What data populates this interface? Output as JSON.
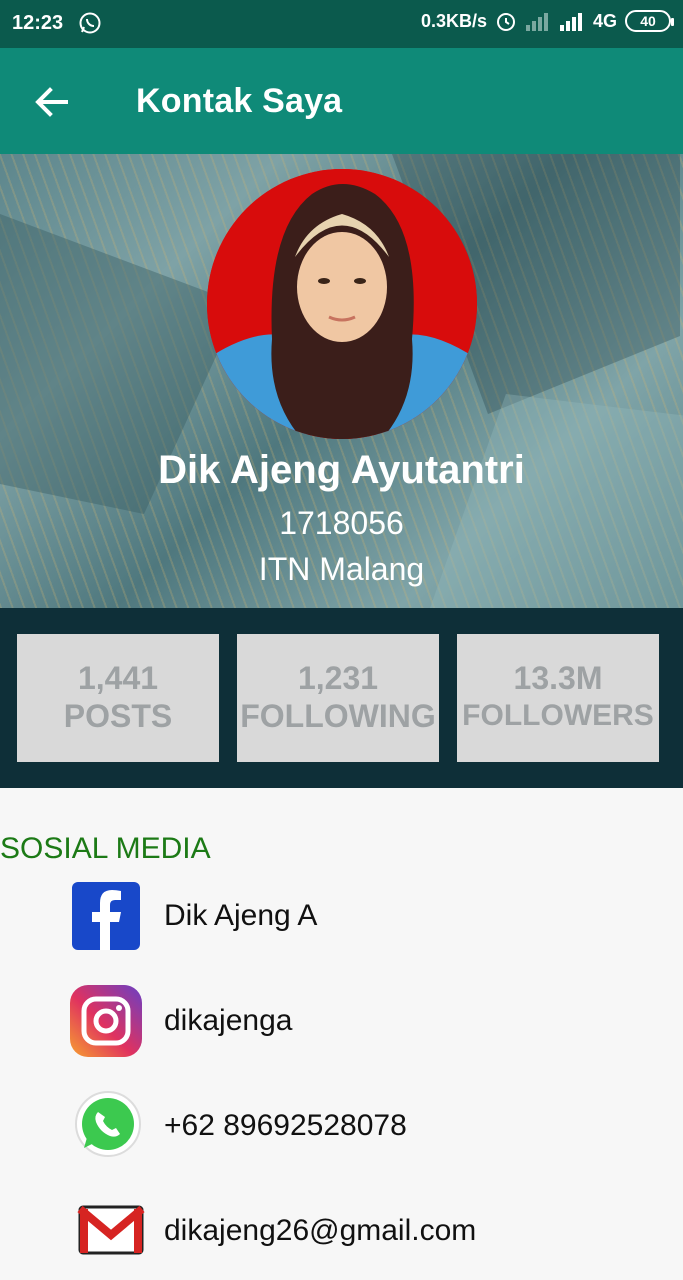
{
  "status_bar": {
    "time": "12:23",
    "net_speed": "0.3KB/s",
    "network": "4G",
    "battery": "40"
  },
  "app_bar": {
    "title": "Kontak Saya",
    "back_icon": "arrow-left-icon"
  },
  "profile": {
    "name": "Dik Ajeng Ayutantri",
    "id": "1718056",
    "campus": "ITN Malang"
  },
  "stats": [
    {
      "value": "1,441",
      "label": "POSTS"
    },
    {
      "value": "1,231",
      "label": "FOLLOWING"
    },
    {
      "value": "13.3M",
      "label": "FOLLOWERS"
    }
  ],
  "social": {
    "title": "SOSIAL MEDIA",
    "items": [
      {
        "icon": "facebook-icon",
        "text": "Dik Ajeng A"
      },
      {
        "icon": "instagram-icon",
        "text": "dikajenga"
      },
      {
        "icon": "whatsapp-icon",
        "text": "+62 89692528078"
      },
      {
        "icon": "gmail-icon",
        "text": "dikajeng26@gmail.com"
      }
    ]
  },
  "colors": {
    "status_bar": "#0b5a4d",
    "app_bar": "#0f8a78",
    "stats_bg": "#0e2f38",
    "section_title": "#1c7a16"
  }
}
